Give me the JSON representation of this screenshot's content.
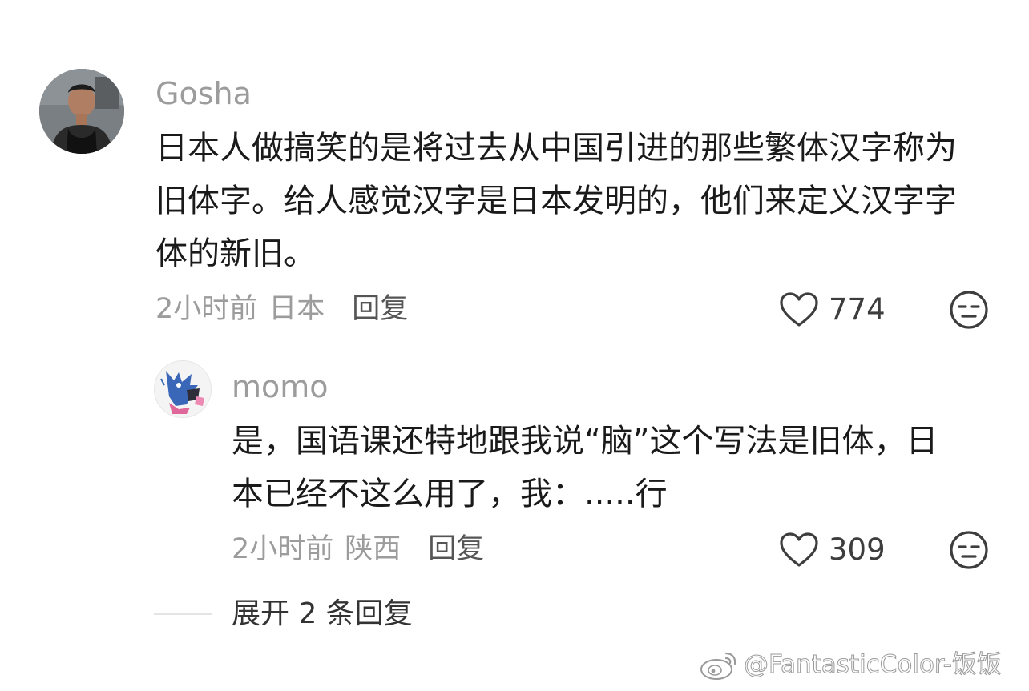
{
  "comment": {
    "username": "Gosha",
    "text_lines": [
      "日本人做搞笑的是将过去从中国引进的那些繁体汉字称为",
      "旧体字。给人感觉汉字是日本发明的，他们来定义汉字字",
      "体的新旧。"
    ],
    "time": "2小时前",
    "location": "日本",
    "reply_label": "回复",
    "like_count": "774",
    "like_icon": "heart-outline-icon",
    "dislike_icon": "unamused-face-icon"
  },
  "reply": {
    "username": "momo",
    "text_lines": [
      "是，国语课还特地跟我说“脑”这个写法是旧体，日",
      "本已经不这么用了，我：.....行"
    ],
    "time": "2小时前",
    "location": "陕西",
    "reply_label": "回复",
    "like_count": "309",
    "like_icon": "heart-outline-icon",
    "dislike_icon": "unamused-face-icon"
  },
  "expand_replies": "展开 2 条回复",
  "watermark": "@FantasticColor-饭饭",
  "colors": {
    "username": "#9c9c9c",
    "body": "#1a1a1a",
    "meta": "#9c9c9c"
  }
}
